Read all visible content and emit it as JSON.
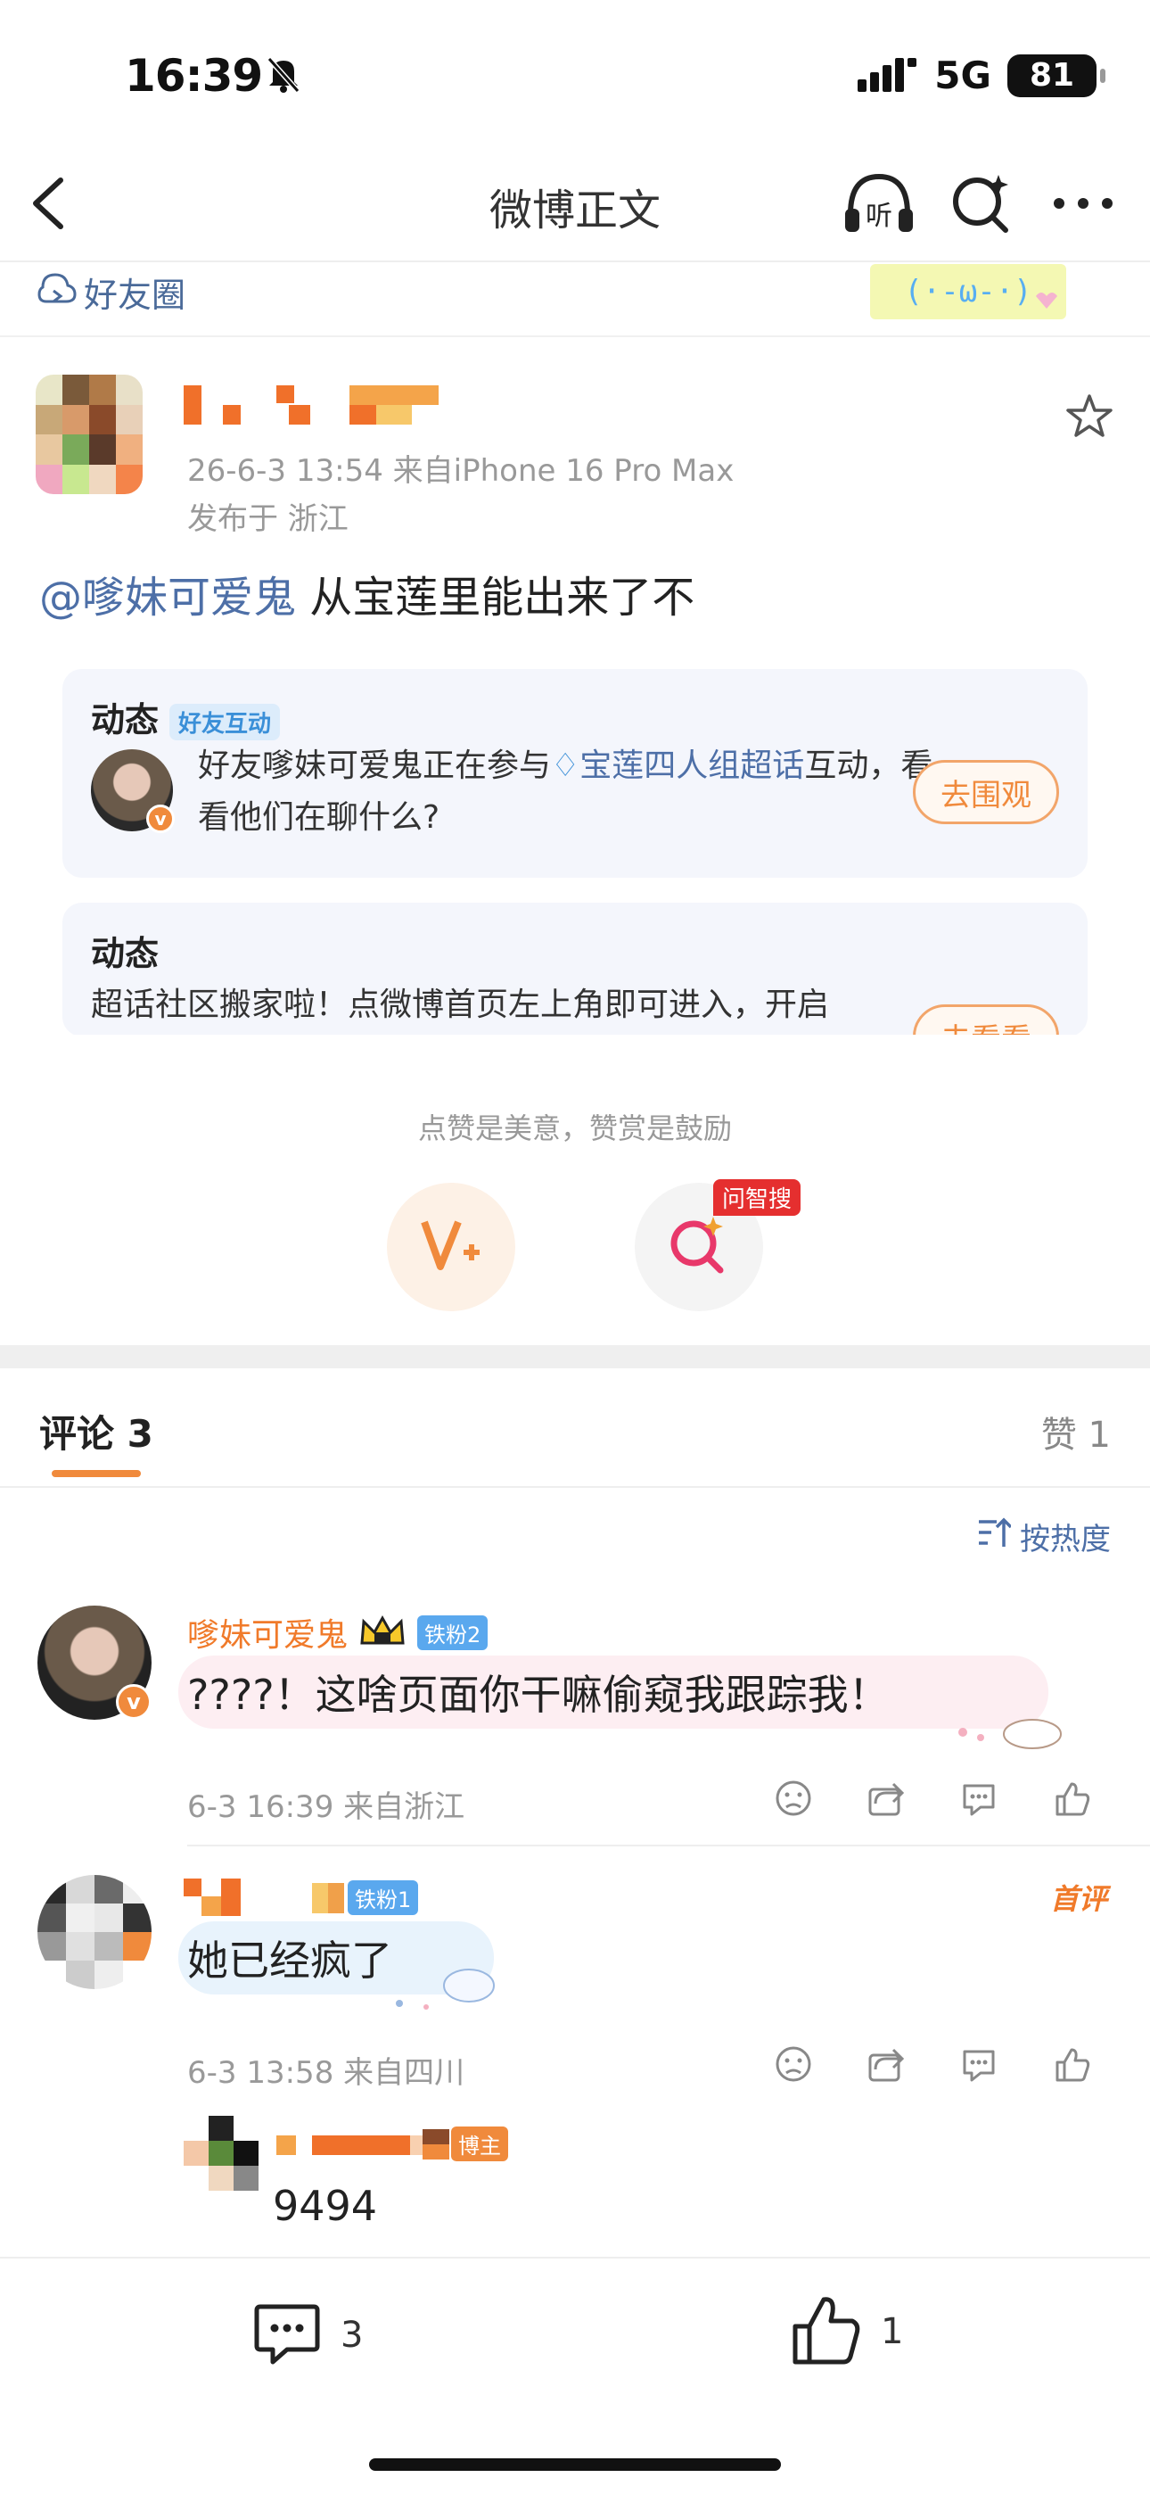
{
  "status_bar": {
    "time": "16:39",
    "network": "5G",
    "battery": "81"
  },
  "nav": {
    "title": "微博正文"
  },
  "friends_circle": {
    "label": "好友圈"
  },
  "post": {
    "meta": "26-6-3 13:54  来自iPhone 16 Pro Max",
    "location": "发布于 浙江",
    "mention": "@嗲妹可爱鬼",
    "text": " 从宝莲里能出来了不"
  },
  "cards": [
    {
      "title": "动态",
      "tag": "好友互动",
      "text_before": "好友嗲妹可爱鬼正在参与",
      "link": "宝莲四人组超话",
      "text_after": "互动，看看他们在聊什么?",
      "button": "去围观"
    },
    {
      "title": "动态",
      "text": "超话社区搬家啦！点微博首页左上角即可进入，开启",
      "button": "去看看"
    }
  ],
  "reward": {
    "caption": "点赞是美意，赞赏是鼓励",
    "ai_badge": "问智搜"
  },
  "tabs": {
    "comments": "评论 3",
    "likes": "赞 1"
  },
  "sort": {
    "label": "按热度"
  },
  "comments": [
    {
      "name": "嗲妹可爱鬼",
      "fan_badge": "铁粉2",
      "text": "????！这啥页面你干嘛偷窥我跟踪我！",
      "meta": "6-3 16:39  来自浙江"
    },
    {
      "fan_badge": "铁粉1",
      "first_badge": "首评",
      "text": "她已经疯了",
      "meta": "6-3 13:58  来自四川",
      "reply": {
        "host_badge": "博主",
        "text": "9494"
      }
    }
  ],
  "bottom_bar": {
    "comment_count": "3",
    "like_count": "1"
  },
  "colors": {
    "accent_orange": "#f08a3c",
    "link_blue": "#4d6fa7",
    "fan_blue": "#5aa8ee"
  }
}
